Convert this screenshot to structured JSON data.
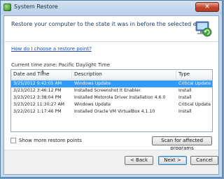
{
  "window": {
    "title": "System Restore",
    "close_label": "✕"
  },
  "header": {
    "title": "Restore your computer to the state it was in before the selected event"
  },
  "help_link": "How do I choose a restore point?",
  "timezone_text": "Current time zone: Pacific Daylight Time",
  "table": {
    "columns": [
      "Date and Time",
      "Description",
      "Type"
    ],
    "rows": [
      {
        "date": "3/25/2012 9:42:05 AM",
        "description": "Windows Update",
        "type": "Critical Update",
        "selected": true
      },
      {
        "date": "3/23/2012 3:46:12 PM",
        "description": "Installed Screenshot It Enabler.",
        "type": "Install"
      },
      {
        "date": "3/23/2012 3:38:04 PM",
        "description": "Installed Motorola Driver Installation 4.6.0",
        "type": "Install"
      },
      {
        "date": "3/23/2012 11:30:27 AM",
        "description": "Windows Update",
        "type": "Critical Update"
      },
      {
        "date": "3/22/2012 1:17:46 PM",
        "description": "Installed Oracle VM VirtualBox 4.1.10",
        "type": "Install"
      }
    ]
  },
  "show_more_label": "Show more restore points",
  "scan_button": "Scan for affected programs",
  "buttons": {
    "back": "< Back",
    "next": "Next >",
    "cancel": "Cancel"
  }
}
